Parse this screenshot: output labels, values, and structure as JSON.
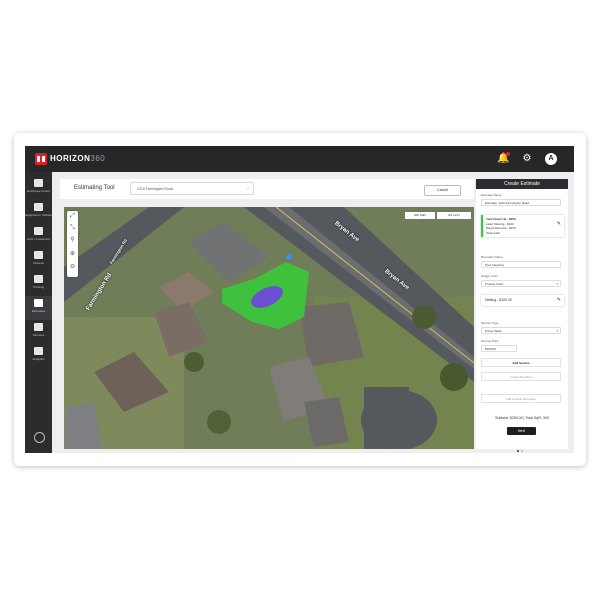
{
  "app": {
    "brand": "HORIZON",
    "brand_suffix": "360",
    "avatar_initial": "A"
  },
  "sidebar": {
    "items": [
      {
        "label": "Employee Crews"
      },
      {
        "label": "Equipment / Vehicle"
      },
      {
        "label": "Jobs / Customers"
      },
      {
        "label": "Invoices"
      },
      {
        "label": "Tracking"
      },
      {
        "label": "Estimates"
      },
      {
        "label": "Services"
      },
      {
        "label": "Analytics"
      }
    ]
  },
  "estimating": {
    "title": "Estimating Tool",
    "address": "1215 Farmington Road",
    "cancel_label": "Cancel",
    "total_sqft_label": "300 SqFt",
    "total_linft_label": "0/0 LinFt"
  },
  "map": {
    "streets": [
      "Farmington Rd",
      "Bryan Ave",
      "Bryan Ave",
      "Farmington Rd"
    ]
  },
  "panel": {
    "header": "Create Estimate",
    "estimate_name_label": "Estimate Name",
    "estimate_name_value": "Estimate: 1215 Farmington Road",
    "service_card_lines": [
      "Yard Clean Up - $259",
      "Lawn Mowing - $100",
      "Weed Removal - $159",
      "(Sub-total)"
    ],
    "boundary_name_label": "Boundary Name",
    "boundary_name_value": "Pool Cleaning",
    "assign_color_label": "Assign Color",
    "assign_color_value": "Choose Color",
    "netting_card": "Netting - $100.00",
    "service_type_label": "Service Type",
    "service_type_value": "Power Wash",
    "service_price_label": "Service Price",
    "service_price_value": "$150.00",
    "add_service_label": "Add Service",
    "create_boundary_label": "Create Boundary",
    "add_another_label": "Add Another Boundary",
    "subtotal_text": "Subtotal: $259.00  |  Total SqFt: 300",
    "next_label": "Next"
  }
}
